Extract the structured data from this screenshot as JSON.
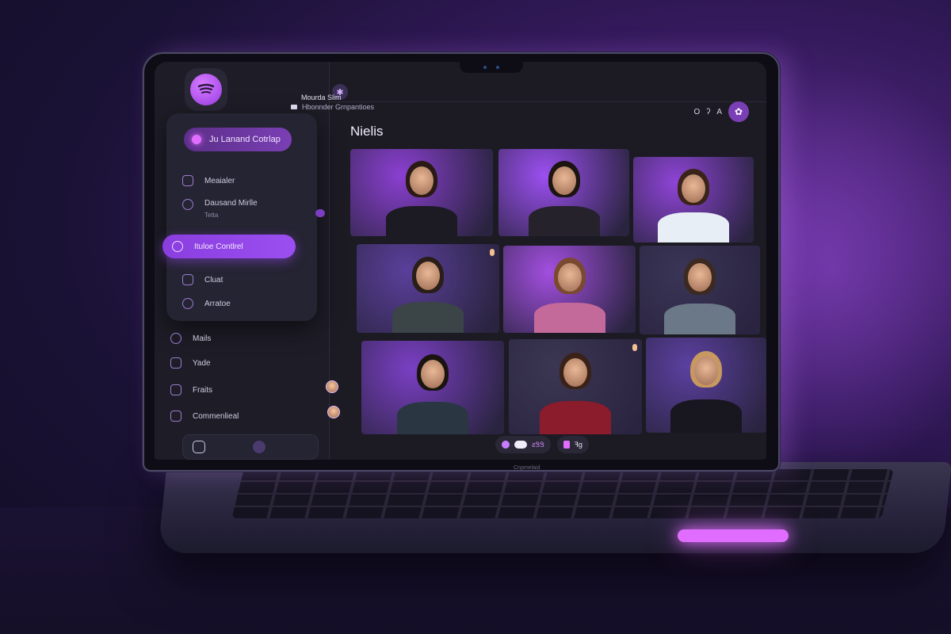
{
  "colors": {
    "accent": "#9b4ff0",
    "accent_pink": "#e06dff",
    "panel": "#252432",
    "background": "#1c1b24"
  },
  "sidebar": {
    "logo_icon": "spotify-like-logo-icon",
    "top_pill": {
      "label": "Ju Lanand Cotrlap",
      "icon": "record-dot-icon"
    },
    "items": [
      {
        "label": "Meaialer",
        "sub": "",
        "icon": "inbox-icon"
      },
      {
        "label": "Dausand Mirlle",
        "sub": "Tetta",
        "icon": "globe-icon"
      },
      {
        "label": "Ituloe Contlrel",
        "sub": "",
        "icon": "gear-icon",
        "active": true
      },
      {
        "label": "Cluat",
        "sub": "",
        "icon": "chat-icon"
      },
      {
        "label": "Arratoe",
        "sub": "",
        "icon": "person-icon"
      },
      {
        "label": "Mails",
        "sub": "",
        "icon": "mail-icon"
      },
      {
        "label": "Yade",
        "sub": "",
        "icon": "video-icon"
      },
      {
        "label": "Fraits",
        "sub": "",
        "icon": "folder-icon"
      },
      {
        "label": "Commenlieal",
        "sub": "",
        "icon": "comment-icon"
      }
    ]
  },
  "header": {
    "title": "Mourda Slim",
    "subtitle": "Hbonnder Grnpantioes",
    "right_icons": [
      "O",
      "ʔ",
      "A"
    ]
  },
  "page": {
    "title": "Nielis"
  },
  "participants": [
    {
      "name": "participant-1",
      "bg": "#8a3fd0"
    },
    {
      "name": "participant-2",
      "bg": "#9b4ff0"
    },
    {
      "name": "participant-3",
      "bg": "#8e44d6"
    },
    {
      "name": "participant-4",
      "bg": "#5a3f9a"
    },
    {
      "name": "participant-5",
      "bg": "#a34fe0"
    },
    {
      "name": "participant-6",
      "bg": "#3a3556"
    },
    {
      "name": "participant-7",
      "bg": "#7a3fc4"
    },
    {
      "name": "participant-8",
      "bg": "#3b3652"
    },
    {
      "name": "participant-9",
      "bg": "#5b40a0"
    }
  ],
  "controls": {
    "pill1_text": "",
    "pill2_text": "ƨᏕᏕ",
    "pill3_text": "ꟻg",
    "label": "Cnpmelaid"
  }
}
